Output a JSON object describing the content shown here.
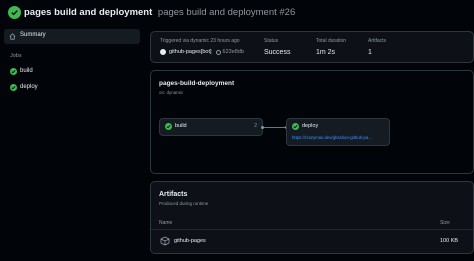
{
  "header": {
    "workflow_name": "pages build and deployment",
    "run_title": "pages build and deployment #26"
  },
  "sidebar": {
    "summary_label": "Summary",
    "jobs_heading": "Jobs",
    "jobs": [
      {
        "label": "build"
      },
      {
        "label": "deploy"
      }
    ]
  },
  "summary": {
    "trigger_label": "Triggered via dynamic 23 hours ago",
    "actor": "github-pages[bot]",
    "commit": "623e8db",
    "status_label": "Status",
    "status_value": "Success",
    "duration_label": "Total duration",
    "duration_value": "1m 2s",
    "artifacts_label": "Artifacts",
    "artifacts_value": "1"
  },
  "workflow": {
    "title": "pages-build-deployment",
    "trigger": "on: dynamic",
    "jobs": {
      "build": {
        "name": "build",
        "duration": "2"
      },
      "deploy": {
        "name": "deploy",
        "duration": "",
        "url": "https://crazymax.dev/ghaction-github-pa..."
      }
    }
  },
  "artifacts": {
    "title": "Artifacts",
    "subtitle": "Produced during runtime",
    "col_name": "Name",
    "col_size": "Size",
    "items": [
      {
        "name": "github-pages",
        "size": "100 KB"
      }
    ]
  },
  "colors": {
    "success": "#3fb950",
    "link": "#4493f8",
    "background": "#010409",
    "panel": "#0d1117",
    "border": "#30363d"
  },
  "icons": [
    "check-circle-icon",
    "home-icon",
    "github-mark-icon",
    "commit-icon",
    "package-icon"
  ]
}
